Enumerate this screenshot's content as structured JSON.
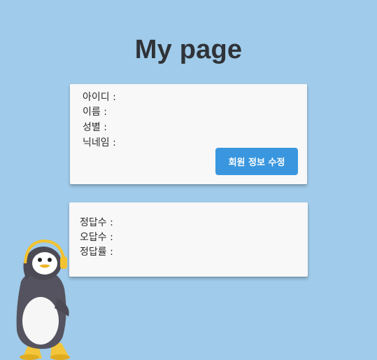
{
  "page": {
    "title": "My page"
  },
  "profile": {
    "id_label": "아이디 :",
    "name_label": "이름 :",
    "gender_label": "성별 :",
    "nickname_label": "닉네임 :",
    "edit_button_label": "회원 정보 수정"
  },
  "stats": {
    "correct_label": "정답수 :",
    "wrong_label": "오답수 :",
    "accuracy_label": "정답률 :"
  },
  "colors": {
    "background": "#a0cbea",
    "card": "#f8f8f8",
    "accent": "#3a97df"
  },
  "images": {
    "mascot": "penguin-mascot"
  }
}
